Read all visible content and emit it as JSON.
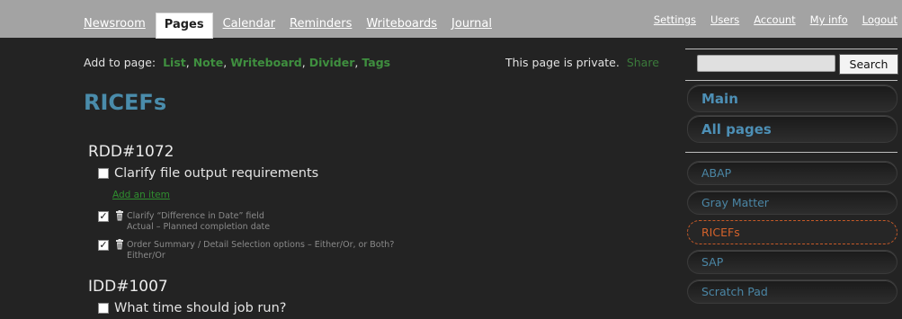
{
  "nav": {
    "tabs": [
      {
        "label": "Newsroom"
      },
      {
        "label": "Pages"
      },
      {
        "label": "Calendar"
      },
      {
        "label": "Reminders"
      },
      {
        "label": "Writeboards"
      },
      {
        "label": "Journal"
      }
    ],
    "active_tab": "Pages",
    "top_links": [
      {
        "label": "Settings"
      },
      {
        "label": "Users"
      },
      {
        "label": "Account"
      },
      {
        "label": "My info"
      },
      {
        "label": "Logout"
      }
    ]
  },
  "add_bar": {
    "prefix": "Add to page:",
    "links": [
      {
        "label": "List"
      },
      {
        "label": "Note"
      },
      {
        "label": "Writeboard"
      },
      {
        "label": "Divider"
      },
      {
        "label": "Tags"
      }
    ]
  },
  "privacy": {
    "text": "This page is private.",
    "share_label": "Share"
  },
  "page": {
    "title": "RICEFs",
    "lists": [
      {
        "title": "RDD#1072",
        "open_items": [
          "Clarify file output requirements"
        ],
        "add_item_label": "Add an item",
        "completed_items": [
          {
            "line1": "Clarify “Difference in Date” field",
            "line2": "Actual – Planned completion date"
          },
          {
            "line1": "Order Summary / Detail Selection options – Either/Or, or Both?",
            "line2": "Either/Or"
          }
        ]
      },
      {
        "title": "IDD#1007",
        "open_items": [
          "What time should job run?"
        ]
      }
    ]
  },
  "sidebar": {
    "search": {
      "value": "",
      "button_label": "Search"
    },
    "primary": [
      {
        "label": "Main"
      },
      {
        "label": "All pages"
      }
    ],
    "pages": [
      {
        "label": "ABAP"
      },
      {
        "label": "Gray Matter"
      },
      {
        "label": "RICEFs"
      },
      {
        "label": "SAP"
      },
      {
        "label": "Scratch Pad"
      }
    ],
    "active_page": "RICEFs"
  },
  "colors": {
    "accent_blue": "#4a8cab",
    "link_green": "#3f8f3f",
    "active_orange": "#d4622b",
    "background": "#232323",
    "topbar": "#a3a3a3"
  }
}
